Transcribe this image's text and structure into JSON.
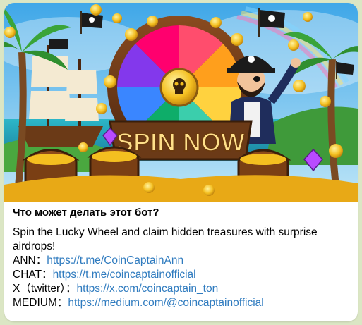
{
  "banner": {
    "headline": "SPIN NOW"
  },
  "bot_info": {
    "title": "Что может делать этот бот?",
    "description": "Spin the Lucky Wheel and claim hidden treasures with surprise airdrops!",
    "links": [
      {
        "label": "ANN",
        "separator": "：",
        "url": "https://t.me/CoinCaptainAnn"
      },
      {
        "label": "CHAT",
        "separator": "：",
        "url": "https://t.me/coincaptainofficial"
      },
      {
        "label": "X（twitter）",
        "separator": "：",
        "url": "https://x.com/coincaptain_ton"
      },
      {
        "label": "MEDIUM",
        "separator": "：",
        "url": "https://medium.com/@coincaptainofficial"
      }
    ]
  },
  "colors": {
    "link": "#2f7bbf",
    "chat_background": "#dbe6c4",
    "card_background": "#ffffff"
  }
}
